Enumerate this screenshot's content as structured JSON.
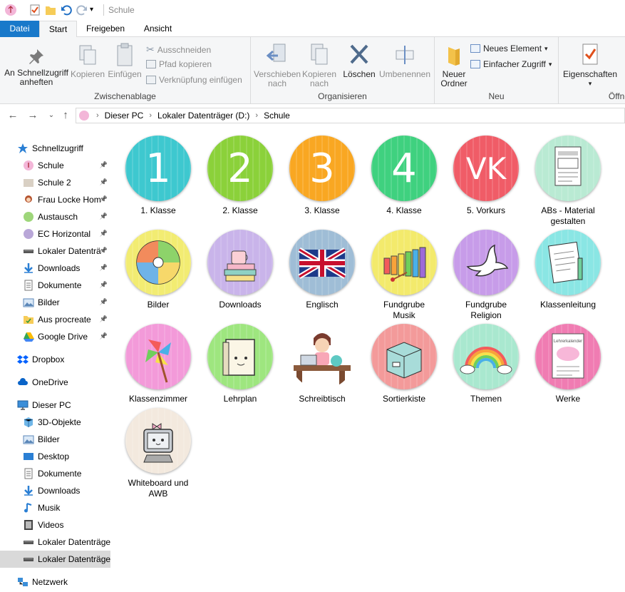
{
  "window": {
    "title": "Schule"
  },
  "tabs": {
    "file": "Datei",
    "start": "Start",
    "share": "Freigeben",
    "view": "Ansicht"
  },
  "ribbon": {
    "pin": "An Schnellzugriff anheften",
    "copy": "Kopieren",
    "paste": "Einfügen",
    "cut": "Ausschneiden",
    "copy_path": "Pfad kopieren",
    "paste_link": "Verknüpfung einfügen",
    "clipboard_group": "Zwischenablage",
    "move_to": "Verschieben nach",
    "copy_to": "Kopieren nach",
    "delete": "Löschen",
    "rename": "Umbenennen",
    "organize_group": "Organisieren",
    "new_folder": "Neuer Ordner",
    "new_item": "Neues Element",
    "easy_access": "Einfacher Zugriff",
    "new_group": "Neu",
    "properties": "Eigenschaften",
    "open_group": "Öffne"
  },
  "address": {
    "segments": [
      "Dieser PC",
      "Lokaler Datenträger (D:)",
      "Schule"
    ]
  },
  "sidebar": [
    {
      "label": "Schnellzugriff",
      "icon": "star-icon",
      "pinned": false,
      "indent": 0,
      "selected": false
    },
    {
      "label": "Schule",
      "icon": "custom-folder-icon",
      "pinned": true,
      "indent": 1,
      "selected": false
    },
    {
      "label": "Schule 2",
      "icon": "folder-thumb-icon",
      "pinned": true,
      "indent": 1,
      "selected": false
    },
    {
      "label": "Frau Locke Hom",
      "icon": "avatar-folder-icon",
      "pinned": true,
      "indent": 1,
      "selected": false
    },
    {
      "label": "Austausch",
      "icon": "green-folder-icon",
      "pinned": true,
      "indent": 1,
      "selected": false
    },
    {
      "label": "EC Horizontal",
      "icon": "purple-folder-icon",
      "pinned": true,
      "indent": 1,
      "selected": false
    },
    {
      "label": "Lokaler Datenträ",
      "icon": "drive-icon",
      "pinned": true,
      "indent": 1,
      "selected": false
    },
    {
      "label": "Downloads",
      "icon": "download-icon",
      "pinned": true,
      "indent": 1,
      "selected": false
    },
    {
      "label": "Dokumente",
      "icon": "document-icon",
      "pinned": true,
      "indent": 1,
      "selected": false
    },
    {
      "label": "Bilder",
      "icon": "pictures-icon",
      "pinned": true,
      "indent": 1,
      "selected": false
    },
    {
      "label": "Aus procreate",
      "icon": "yellow-folder-icon",
      "pinned": true,
      "indent": 1,
      "selected": false
    },
    {
      "label": "Google Drive",
      "icon": "google-drive-icon",
      "pinned": true,
      "indent": 1,
      "selected": false
    },
    {
      "label": "Dropbox",
      "icon": "dropbox-icon",
      "pinned": false,
      "indent": 0,
      "selected": false
    },
    {
      "label": "OneDrive",
      "icon": "cloud-icon",
      "pinned": false,
      "indent": 0,
      "selected": false
    },
    {
      "label": "Dieser PC",
      "icon": "computer-icon",
      "pinned": false,
      "indent": 0,
      "selected": false
    },
    {
      "label": "3D-Objekte",
      "icon": "cube-icon",
      "pinned": false,
      "indent": 1,
      "selected": false
    },
    {
      "label": "Bilder",
      "icon": "pictures-icon",
      "pinned": false,
      "indent": 1,
      "selected": false
    },
    {
      "label": "Desktop",
      "icon": "desktop-icon",
      "pinned": false,
      "indent": 1,
      "selected": false
    },
    {
      "label": "Dokumente",
      "icon": "document-icon",
      "pinned": false,
      "indent": 1,
      "selected": false
    },
    {
      "label": "Downloads",
      "icon": "download-icon",
      "pinned": false,
      "indent": 1,
      "selected": false
    },
    {
      "label": "Musik",
      "icon": "music-icon",
      "pinned": false,
      "indent": 1,
      "selected": false
    },
    {
      "label": "Videos",
      "icon": "video-icon",
      "pinned": false,
      "indent": 1,
      "selected": false
    },
    {
      "label": "Lokaler Datenträge",
      "icon": "drive-icon",
      "pinned": false,
      "indent": 1,
      "selected": false
    },
    {
      "label": "Lokaler Datenträge",
      "icon": "drive-icon",
      "pinned": false,
      "indent": 1,
      "selected": true
    },
    {
      "label": "Netzwerk",
      "icon": "network-icon",
      "pinned": false,
      "indent": 0,
      "selected": false
    }
  ],
  "folders": [
    {
      "label": "1. Klasse",
      "icon": "number-1-icon",
      "text": "1",
      "color": "#3ec8cf"
    },
    {
      "label": "2. Klasse",
      "icon": "number-2-icon",
      "text": "2",
      "color": "#8bd13a"
    },
    {
      "label": "3. Klasse",
      "icon": "number-3-icon",
      "text": "3",
      "color": "#f9a722"
    },
    {
      "label": "4. Klasse",
      "icon": "number-4-icon",
      "text": "4",
      "color": "#3fd17f"
    },
    {
      "label": "5. Vorkurs",
      "icon": "vk-icon",
      "text": "VK",
      "color": "#f05c67"
    },
    {
      "label": "ABs - Material gestalten",
      "icon": "worksheet-icon",
      "text": "",
      "color": "#b9ead3"
    },
    {
      "label": "Bilder",
      "icon": "pie-pictures-icon",
      "text": "",
      "color": "#f2ec72"
    },
    {
      "label": "Downloads",
      "icon": "books-cup-icon",
      "text": "",
      "color": "#c9b4ea"
    },
    {
      "label": "Englisch",
      "icon": "union-jack-icon",
      "text": "",
      "color": "#9fbdd6"
    },
    {
      "label": "Fundgrube Musik",
      "icon": "xylophone-icon",
      "text": "",
      "color": "#f3ea6c"
    },
    {
      "label": "Fundgrube Religion",
      "icon": "dove-icon",
      "text": "",
      "color": "#c79ce9"
    },
    {
      "label": "Klassenleitung",
      "icon": "notebook-icon",
      "text": "",
      "color": "#8ae6e4"
    },
    {
      "label": "Klassenzimmer",
      "icon": "pinwheel-icon",
      "text": "",
      "color": "#f39ad9"
    },
    {
      "label": "Lehrplan",
      "icon": "book-face-icon",
      "text": "",
      "color": "#9ee67f"
    },
    {
      "label": "Schreibtisch",
      "icon": "teacher-desk-icon",
      "text": "",
      "color": "#ffffff"
    },
    {
      "label": "Sortierkiste",
      "icon": "box-icon",
      "text": "",
      "color": "#f39a9a"
    },
    {
      "label": "Themen",
      "icon": "rainbow-icon",
      "text": "",
      "color": "#a9e8cf"
    },
    {
      "label": "Werke",
      "icon": "calendar-icon",
      "text": "",
      "color": "#f07cb2"
    },
    {
      "label": "Whiteboard und AWB",
      "icon": "computer-face-icon",
      "text": "",
      "color": "#f3e9de"
    }
  ],
  "werke_cover_text": "Lehrerkalender"
}
